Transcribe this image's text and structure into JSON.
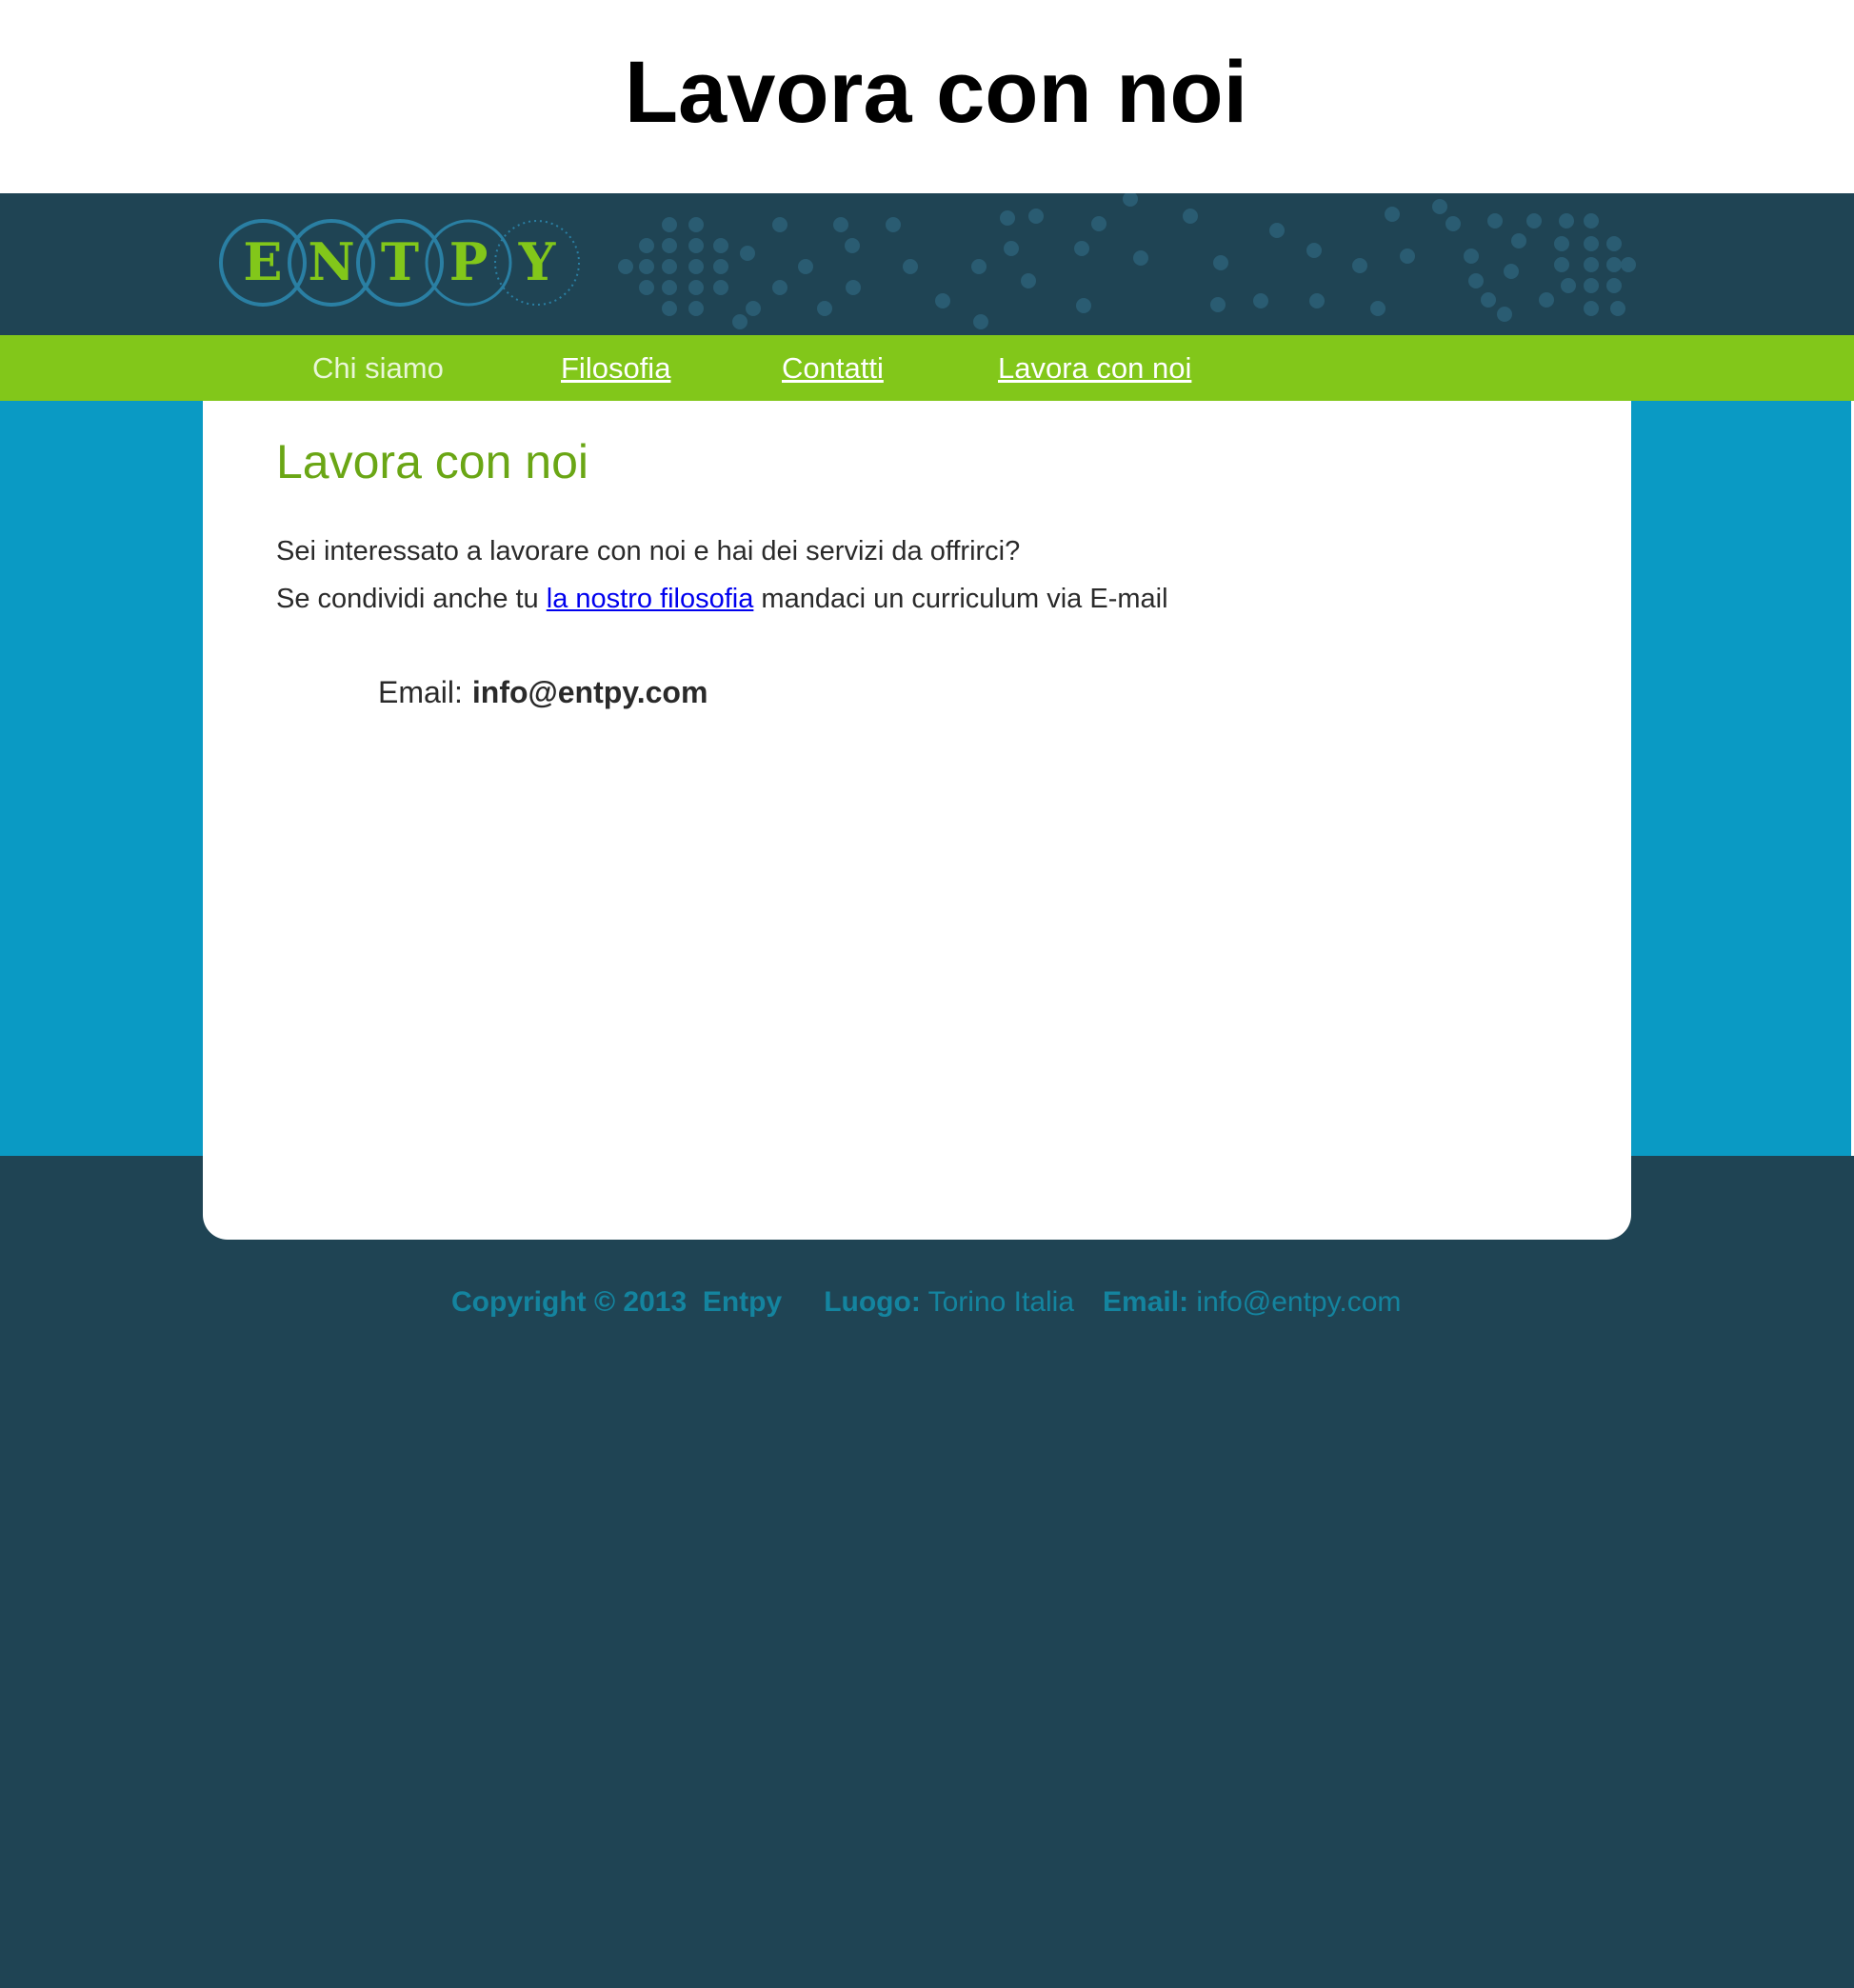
{
  "page_title": "Lavora con noi",
  "logo": {
    "letters": [
      "E",
      "N",
      "T",
      "P",
      "Y"
    ],
    "ring_color": "#2a7fa3",
    "letter_color": "#82c71a"
  },
  "colors": {
    "header_bg": "#1f4454",
    "nav_bg": "#82c71a",
    "main_bg": "#0a9ac4",
    "heading_green": "#6aa615",
    "footer_text": "#14849f"
  },
  "nav": {
    "items": [
      {
        "label": "Chi siamo",
        "linked": false
      },
      {
        "label": "Filosofia",
        "linked": true
      },
      {
        "label": "Contatti",
        "linked": true
      },
      {
        "label": "Lavora con noi",
        "linked": true
      }
    ]
  },
  "content": {
    "heading": "Lavora con noi",
    "line1": "Sei interessato a lavorare con noi e hai dei servizi da offrirci?",
    "line2_before": "Se condividi anche tu ",
    "line2_link": "la nostro filosofia",
    "line2_after": " mandaci un curriculum via E-mail",
    "email_label": "Email:",
    "email_value": "info@entpy.com"
  },
  "footer": {
    "copyright": "Copyright © 2013",
    "brand": "Entpy",
    "location_label": "Luogo:",
    "location_value": "Torino Italia",
    "email_label": "Email:",
    "email_value": "info@entpy.com"
  }
}
